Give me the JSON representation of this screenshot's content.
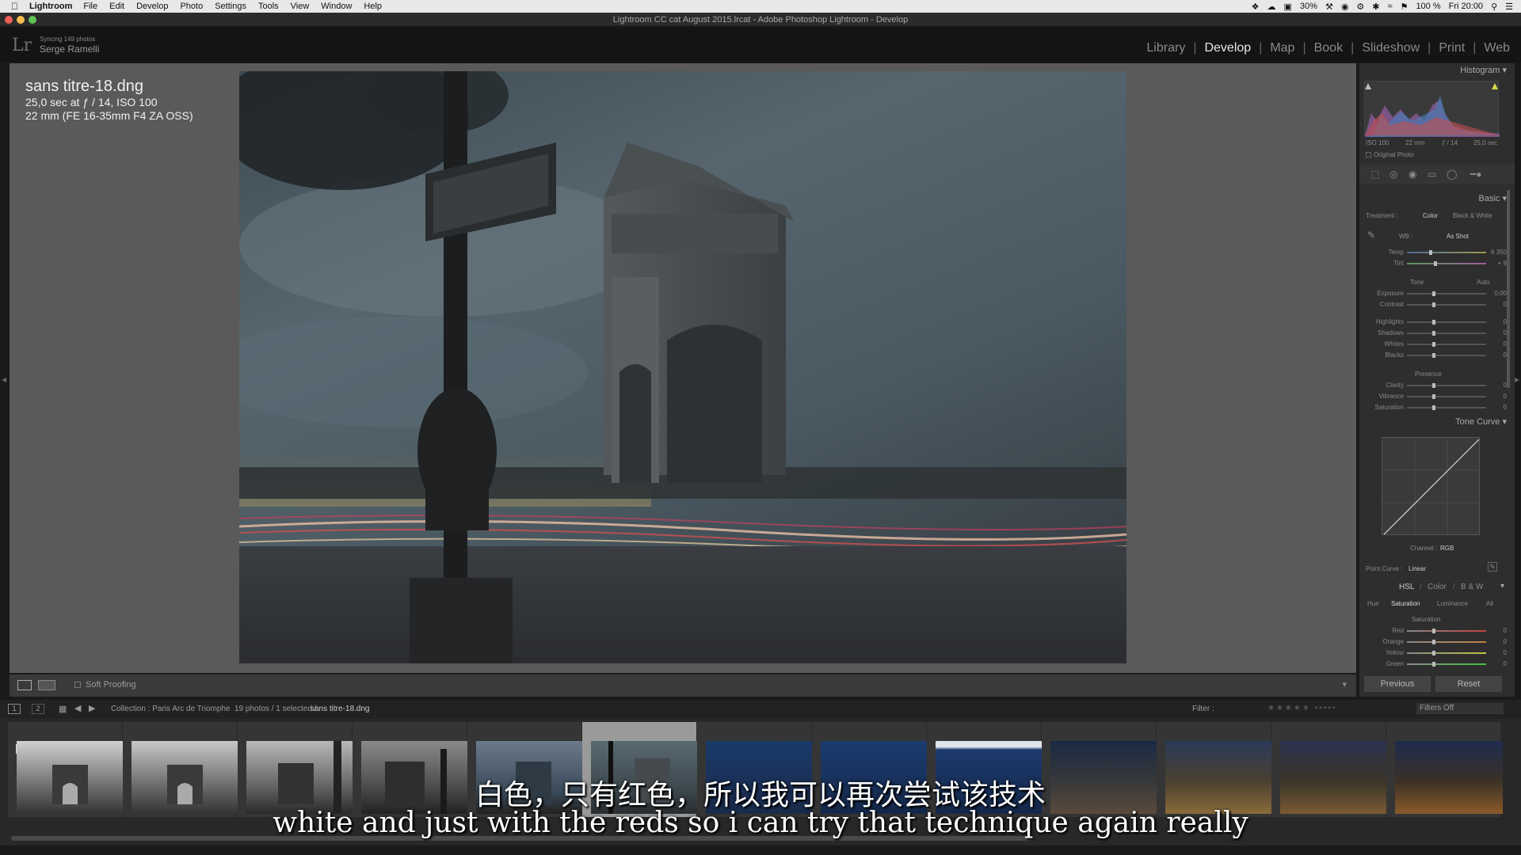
{
  "menubar": {
    "app": "Lightroom",
    "items": [
      "File",
      "Edit",
      "Develop",
      "Photo",
      "Settings",
      "Tools",
      "View",
      "Window",
      "Help"
    ],
    "battery": "30%",
    "volume": "100 %",
    "clock": "Fri 20:00"
  },
  "window": {
    "title": "Lightroom CC cat August 2015.lrcat - Adobe Photoshop Lightroom - Develop"
  },
  "identity": {
    "logo": "Lr",
    "sync_status": "Syncing 149 photos",
    "user": "Serge Ramelli"
  },
  "modules": [
    {
      "label": "Library",
      "active": false
    },
    {
      "label": "Develop",
      "active": true
    },
    {
      "label": "Map",
      "active": false
    },
    {
      "label": "Book",
      "active": false
    },
    {
      "label": "Slideshow",
      "active": false
    },
    {
      "label": "Print",
      "active": false
    },
    {
      "label": "Web",
      "active": false
    }
  ],
  "photo_info": {
    "filename": "sans titre-18.dng",
    "exposure": "25,0 sec at ƒ / 14, ISO 100",
    "lens": "22 mm (FE 16-35mm F4 ZA OSS)"
  },
  "toolbar": {
    "soft_proofing": "Soft Proofing"
  },
  "right_panel": {
    "histogram": {
      "title": "Histogram",
      "iso": "ISO 100",
      "focal": "22 mm",
      "aperture": "ƒ / 14",
      "shutter": "25,0 sec",
      "original_photo": "Original Photo"
    },
    "basic": {
      "title": "Basic",
      "treatment_label": "Treatment :",
      "color": "Color",
      "bw": "Black & White",
      "wb_label": "WB :",
      "wb_value": "As Shot",
      "temp_label": "Temp",
      "temp_value": "6 350",
      "tint_label": "Tint",
      "tint_value": "+ 9",
      "tone_label": "Tone",
      "auto": "Auto",
      "exposure_label": "Exposure",
      "exposure_value": "0,00",
      "contrast_label": "Contrast",
      "contrast_value": "0",
      "highlights_label": "Highlights",
      "highlights_value": "0",
      "shadows_label": "Shadows",
      "shadows_value": "0",
      "whites_label": "Whites",
      "whites_value": "0",
      "blacks_label": "Blacks",
      "blacks_value": "0",
      "presence_label": "Presence",
      "clarity_label": "Clarity",
      "clarity_value": "0",
      "vibrance_label": "Vibrance",
      "vibrance_value": "0",
      "saturation_label": "Saturation",
      "saturation_value": "0"
    },
    "tone_curve": {
      "title": "Tone Curve",
      "channel_label": "Channel :",
      "channel_value": "RGB",
      "point_curve_label": "Point Curve :",
      "point_curve_value": "Linear"
    },
    "hsl": {
      "hsl": "HSL",
      "color": "Color",
      "bw": "B & W",
      "tabs": [
        "Hue",
        "Saturation",
        "Luminance",
        "All"
      ],
      "section": "Saturation",
      "red_label": "Red",
      "red_value": "0",
      "orange_label": "Orange",
      "orange_value": "0",
      "yellow_label": "Yellow",
      "yellow_value": "0",
      "green_label": "Green",
      "green_value": "0"
    },
    "previous": "Previous",
    "reset": "Reset"
  },
  "filmstrip": {
    "page1": "1",
    "page2": "2",
    "collection": "Collection : Paris Arc de Triomphe",
    "count": "19 photos / 1 selected /",
    "selected_file": "sans titre-18.dng",
    "filter_label": "Filter :",
    "filters_off": "Filters Off",
    "badge_first": "2",
    "thumbnails": 13,
    "selected_index": 5
  },
  "subtitles": {
    "chinese": "白色，只有红色，所以我可以再次尝试该技术",
    "english": "white and just with the reds so i can try that technique again really"
  }
}
